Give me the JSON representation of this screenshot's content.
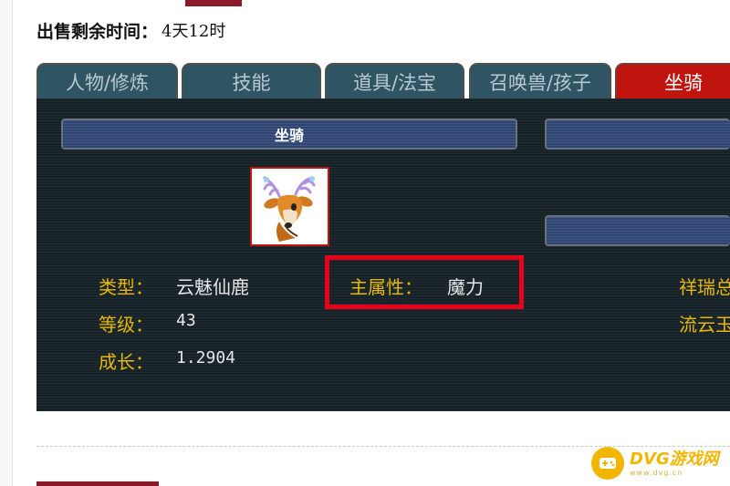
{
  "sale": {
    "label": "出售剩余时间：",
    "value": "4天12时"
  },
  "tabs": [
    {
      "label": "人物/修炼",
      "active": false
    },
    {
      "label": "技能",
      "active": false
    },
    {
      "label": "道具/法宝",
      "active": false
    },
    {
      "label": "召唤兽/孩子",
      "active": false
    },
    {
      "label": "坐骑",
      "active": true
    }
  ],
  "panel": {
    "header_title": "坐骑",
    "portrait_icon": "deer-mount-icon",
    "attributes": {
      "type": {
        "label": "类型：",
        "value": "云魅仙鹿"
      },
      "level": {
        "label": "等级：",
        "value": "43"
      },
      "growth": {
        "label": "成长：",
        "value": "1.2904"
      },
      "main_attr": {
        "label": "主属性：",
        "value": "魔力"
      }
    },
    "right_column": [
      "祥瑞总",
      "流云玉"
    ]
  },
  "watermark": {
    "brand": "DVG游戏网",
    "url": "www.dvg.cn"
  },
  "colors": {
    "panel_bg": "#162227",
    "tab_bg": "#2f5564",
    "tab_active_bg": "#c0140f",
    "header_bar_bg": "#2e4472",
    "label_gold": "#e8b800",
    "highlight_red": "#e8001a",
    "accent_maroon": "#8a1a2a"
  }
}
